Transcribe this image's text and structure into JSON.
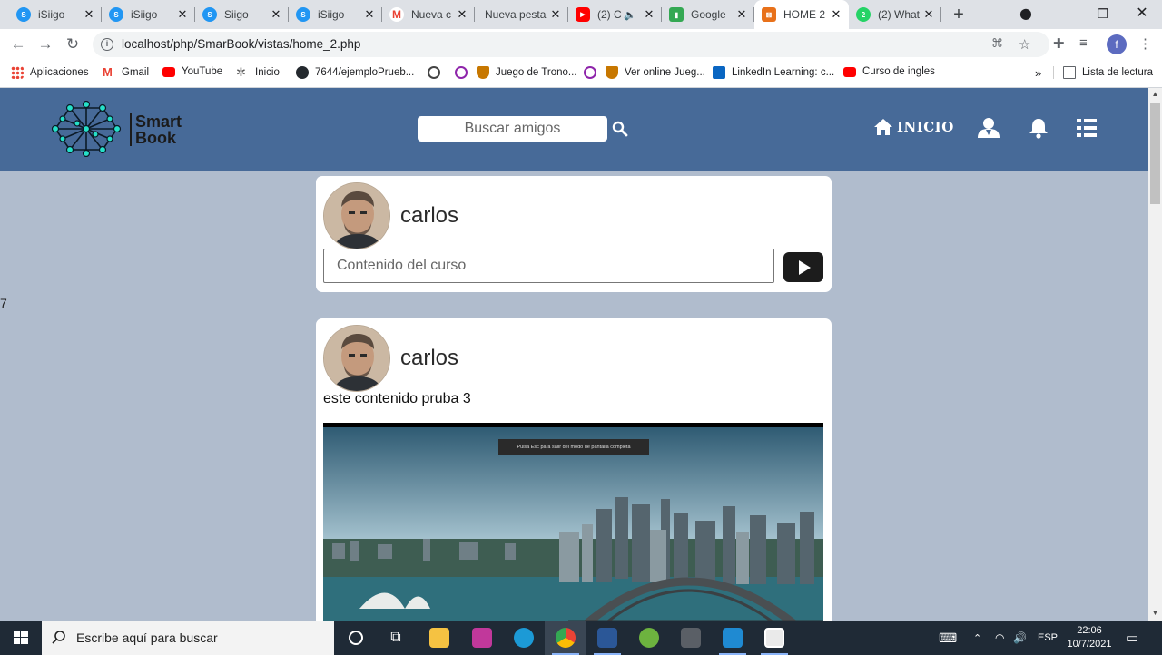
{
  "browser": {
    "tabs": [
      {
        "title": "iSiigo",
        "favicon_color": "#2196f3"
      },
      {
        "title": "iSiigo",
        "favicon_color": "#2196f3"
      },
      {
        "title": "Siigo",
        "favicon_color": "#2196f3"
      },
      {
        "title": "iSiigo",
        "favicon_color": "#2196f3"
      },
      {
        "title": "Nueva c",
        "favicon_color": "#ea4335"
      },
      {
        "title": "Nueva pesta",
        "favicon_color": "#ffffff"
      },
      {
        "title": "(2) C",
        "favicon_color": "#ff0000"
      },
      {
        "title": "Google",
        "favicon_color": "#34a853"
      },
      {
        "title": "HOME 2",
        "favicon_color": "#e8711a"
      },
      {
        "title": "(2) What",
        "favicon_color": "#25d366"
      }
    ],
    "url": "localhost/php/SmarBook/vistas/home_2.php",
    "profile_initial": "f",
    "bookmarks": [
      {
        "label": "Aplicaciones",
        "icon": "apps-grid-icon",
        "color": "#ea4335"
      },
      {
        "label": "Gmail",
        "icon": "gmail-icon",
        "color": "#ea4335"
      },
      {
        "label": "YouTube",
        "icon": "youtube-icon",
        "color": "#ff0000"
      },
      {
        "label": "Inicio",
        "icon": "sena-icon",
        "color": "#555555"
      },
      {
        "label": "7644/ejemploPrueb...",
        "icon": "github-icon",
        "color": "#24292e"
      },
      {
        "label": "",
        "icon": "globe-icon",
        "color": "#444444"
      },
      {
        "label": "",
        "icon": "play-circle-icon",
        "color": "#8e24aa"
      },
      {
        "label": "Juego de Trono...",
        "icon": "shield-icon",
        "color": "#c77700"
      },
      {
        "label": "",
        "icon": "play-circle-icon",
        "color": "#8e24aa"
      },
      {
        "label": "Ver online Jueg...",
        "icon": "shield-icon",
        "color": "#c77700"
      },
      {
        "label": "LinkedIn Learning: c...",
        "icon": "linkedin-learning-icon",
        "color": "#0a66c2"
      },
      {
        "label": "Curso de ingles",
        "icon": "youtube-icon",
        "color": "#ff0000"
      }
    ],
    "bookmarks_overflow": "»",
    "reading_list": "Lista de lectura"
  },
  "app": {
    "logo": {
      "line1": "Smart",
      "line2": "Book"
    },
    "search_placeholder": "Buscar amigos",
    "nav_home_label": "INICIO",
    "nav_color": "#476a98",
    "page_bg": "#b0bccd",
    "side_number": "7",
    "composer": {
      "username": "carlos",
      "input_placeholder": "Contenido del curso"
    },
    "posts": [
      {
        "username": "carlos",
        "text": "este contenido pruba 3",
        "image_overlay_text": "Pulsa Esc para salir del modo de pantalla completa"
      }
    ]
  },
  "taskbar": {
    "search_placeholder": "Escribe aquí para buscar",
    "language": "ESP",
    "time": "22:06",
    "date": "10/7/2021"
  }
}
